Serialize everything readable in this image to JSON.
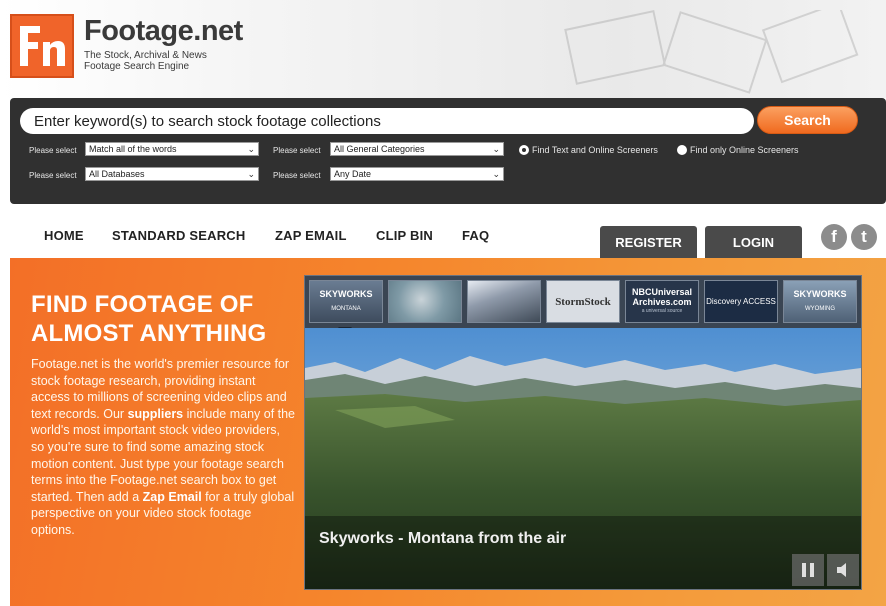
{
  "header": {
    "logo_letters": "Fn",
    "brand_name": "Footage.net",
    "tagline": "The Stock, Archival & News Footage Search Engine"
  },
  "search": {
    "placeholder": "Enter keyword(s) to search stock footage collections",
    "button_label": "Search",
    "select_label": "Please select",
    "match_value": "Match all of the words",
    "category_value": "All General Categories",
    "database_value": "All Databases",
    "date_value": "Any Date",
    "radio_text_online": "Find Text and Online Screeners",
    "radio_online_only": "Find only Online Screeners"
  },
  "nav": {
    "items": [
      "HOME",
      "STANDARD SEARCH",
      "ZAP EMAIL",
      "CLIP BIN",
      "FAQ"
    ],
    "register": "REGISTER",
    "login": "LOGIN",
    "social": [
      "facebook-icon",
      "twitter-icon"
    ]
  },
  "hero": {
    "title": "FIND FOOTAGE OF ALMOST ANYTHING",
    "p1": "Footage.net is the world's premier resource for stock footage research, providing instant access to millions of screening video clips and text records. Our ",
    "suppliers_link": "suppliers",
    "p2": " include many of the world's most important stock video providers, so you're sure to find some amazing stock motion content. Just type your footage search terms into the Footage.net search box to get started. Then add a ",
    "zap_link": "Zap Email",
    "p3": " for a truly global perspective on your video stock footage options."
  },
  "video": {
    "thumbnails": [
      {
        "title": "SKYWORKS",
        "sub": "MONTANA"
      },
      {
        "title": "",
        "sub": ""
      },
      {
        "title": "",
        "sub": ""
      },
      {
        "title": "StormStock",
        "sub": ""
      },
      {
        "title": "NBCUniversal Archives.com",
        "sub": "a universal source"
      },
      {
        "title": "Discovery ACCESS",
        "sub": ""
      },
      {
        "title": "SKYWORKS",
        "sub": "WYOMING"
      }
    ],
    "caption": "Skyworks - Montana from the air",
    "controls": [
      "pause-icon",
      "volume-icon"
    ]
  },
  "colors": {
    "brand_orange": "#f0642a",
    "dark_panel": "#303030",
    "nav_button": "#4a4a4a"
  }
}
